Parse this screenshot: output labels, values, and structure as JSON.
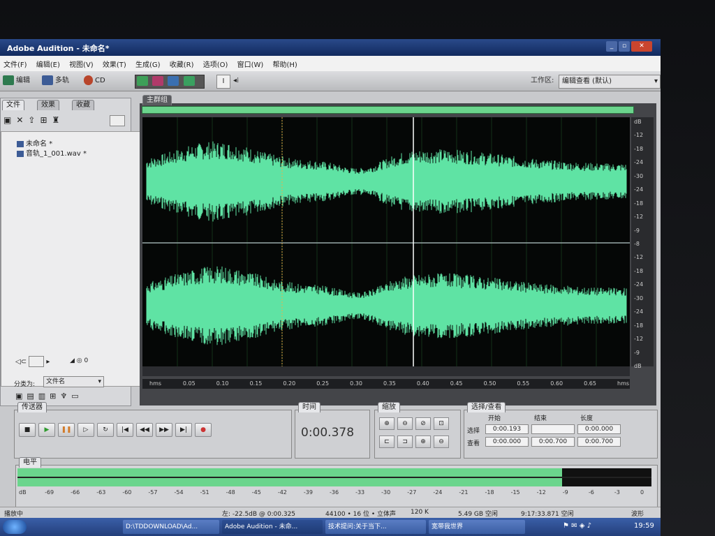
{
  "window": {
    "title": "Adobe Audition - 未命名*"
  },
  "menu": [
    "文件(F)",
    "编辑(E)",
    "视图(V)",
    "效果(T)",
    "生成(G)",
    "收藏(R)",
    "选项(O)",
    "窗口(W)",
    "帮助(H)"
  ],
  "toolbar": {
    "edit_label": "编辑",
    "multitrack_label": "多轨",
    "cd_label": "CD",
    "workspace_label": "工作区:",
    "workspace_value": "编辑查看 (默认)"
  },
  "files_panel": {
    "tabs": [
      "文件",
      "效果",
      "收藏"
    ],
    "items": [
      "未命名 *",
      "音轨_1_001.wav *"
    ],
    "volume": "0",
    "sort_label": "分类为:",
    "sort_value": "文件名"
  },
  "main_panel": {
    "tab": "主群组"
  },
  "db_ruler": [
    "dB",
    "-12",
    "-18",
    "-24",
    "-30",
    "-24",
    "-18",
    "-12",
    "-9",
    "-8",
    "-12",
    "-18",
    "-24",
    "-30",
    "-24",
    "-18",
    "-12",
    "-9",
    "dB"
  ],
  "time_ruler": [
    "hms",
    "0.05",
    "0.10",
    "0.15",
    "0.20",
    "0.25",
    "0.30",
    "0.35",
    "0.40",
    "0.45",
    "0.50",
    "0.55",
    "0.60",
    "0.65",
    "hms"
  ],
  "transport": {
    "tab": "传送器"
  },
  "time": {
    "tab": "时间",
    "value": "0:00.378"
  },
  "zoom": {
    "tab": "缩放"
  },
  "selection": {
    "tab": "选择/查看",
    "col_begin": "开始",
    "col_end": "结束",
    "col_length": "长度",
    "row_select": "选择",
    "row_view": "查看",
    "select_begin": "0:00.193",
    "select_end": "",
    "select_length": "0:00.000",
    "view_begin": "0:00.000",
    "view_end": "0:00.700",
    "view_length": "0:00.700"
  },
  "level": {
    "tab": "电平",
    "ticks": [
      "dB",
      "-69",
      "-66",
      "-63",
      "-60",
      "-57",
      "-54",
      "-51",
      "-48",
      "-45",
      "-42",
      "-39",
      "-36",
      "-33",
      "-30",
      "-27",
      "-24",
      "-21",
      "-18",
      "-15",
      "-12",
      "-9",
      "-6",
      "-3",
      "0"
    ]
  },
  "status": {
    "left": "播放中",
    "db": "左: -22.5dB @ 0:00.325",
    "format": "44100 • 16 位 • 立体声",
    "size": "120 K",
    "free": "5.49 GB 空闲",
    "time_free": "9:17:33.871 空闲",
    "mode": "波形"
  },
  "taskbar": {
    "items": [
      "D:\\TDDOWNLOAD\\Ad...",
      "Adobe Audition - 未命...",
      "技术提问:关于当下...",
      "宽带我世界"
    ],
    "clock": "19:59"
  },
  "colors": {
    "wave": "#5fe3a4",
    "overview": "#6bd58d",
    "wave_bg": "#050706"
  }
}
